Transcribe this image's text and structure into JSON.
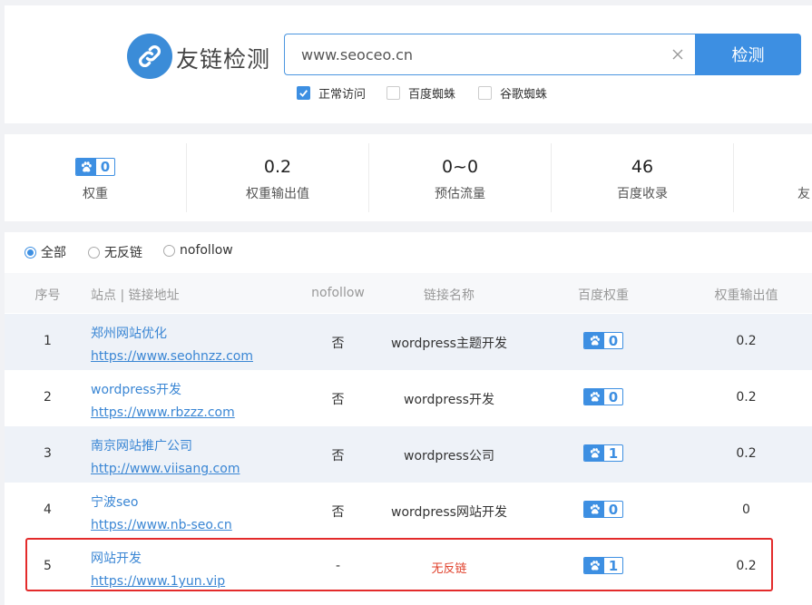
{
  "search": {
    "title": "友链检测",
    "input_value": "www.seoceo.cn",
    "button_label": "检测",
    "options": [
      {
        "label": "正常访问",
        "checked": true
      },
      {
        "label": "百度蜘蛛",
        "checked": false
      },
      {
        "label": "谷歌蜘蛛",
        "checked": false
      }
    ]
  },
  "stats": {
    "weight_value": "0",
    "weight_label": "权重",
    "output_value": "0.2",
    "output_label": "权重输出值",
    "traffic_value": "0~0",
    "traffic_label": "预估流量",
    "index_value": "46",
    "index_label": "百度收录",
    "links_label": "友"
  },
  "filters": [
    {
      "label": "全部",
      "selected": true
    },
    {
      "label": "无反链",
      "selected": false
    },
    {
      "label": "nofollow",
      "selected": false
    }
  ],
  "table": {
    "headers": {
      "index": "序号",
      "site": "站点 | 链接地址",
      "nofollow": "nofollow",
      "anchor": "链接名称",
      "baidu_weight": "百度权重",
      "output": "权重输出值"
    },
    "rows": [
      {
        "index": "1",
        "name": "郑州网站优化",
        "url": "https://www.seohnzz.com",
        "nofollow": "否",
        "anchor": "wordpress主题开发",
        "baidu_weight": "0",
        "output": "0.2"
      },
      {
        "index": "2",
        "name": "wordpress开发",
        "url": "https://www.rbzzz.com",
        "nofollow": "否",
        "anchor": "wordpress开发",
        "baidu_weight": "0",
        "output": "0.2"
      },
      {
        "index": "3",
        "name": "南京网站推广公司",
        "url": "http://www.viisang.com",
        "nofollow": "否",
        "anchor": "wordpress公司",
        "baidu_weight": "1",
        "output": "0.2"
      },
      {
        "index": "4",
        "name": "宁波seo",
        "url": "https://www.nb-seo.cn",
        "nofollow": "否",
        "anchor": "wordpress网站开发",
        "baidu_weight": "0",
        "output": "0"
      },
      {
        "index": "5",
        "name": "网站开发",
        "url": "https://www.1yun.vip",
        "nofollow": "-",
        "anchor": "无反链",
        "baidu_weight": "1",
        "output": "0.2"
      }
    ]
  },
  "colors": {
    "accent": "#3d8fe2",
    "link": "#3a86d4",
    "warning": "#e0402b",
    "highlight_border": "#e32b2b"
  }
}
